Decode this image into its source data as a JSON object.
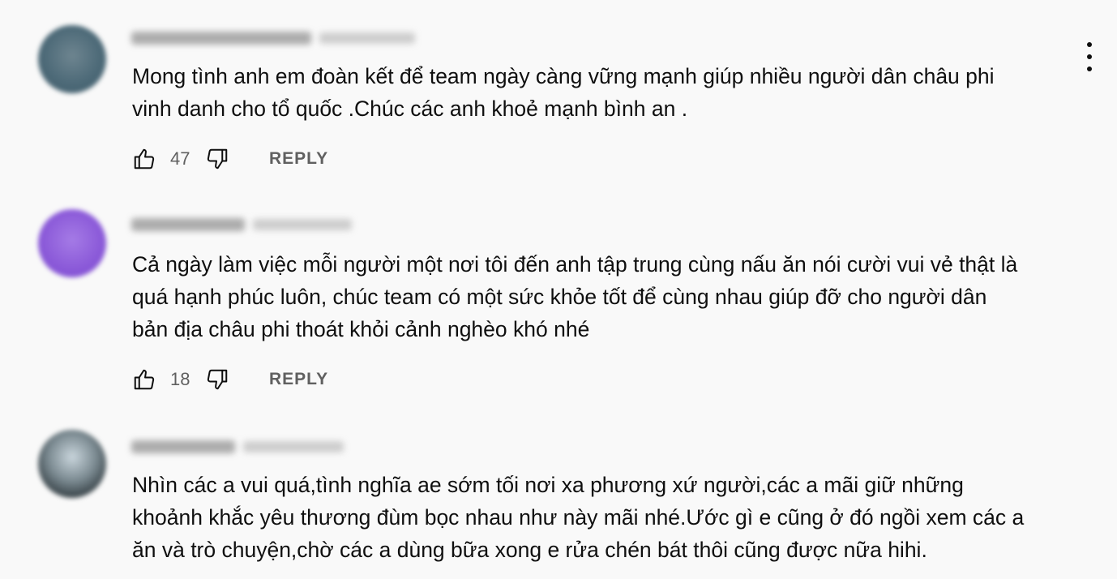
{
  "comments": [
    {
      "text_line1": "Mong tình anh em đoàn kết để team ngày càng vững mạnh giúp nhiều người dân châu phi",
      "text_line2": "vinh danh cho tổ quốc .Chúc các anh khoẻ mạnh bình an .",
      "likes": "47",
      "reply_label": "REPLY"
    },
    {
      "text_line1": "Cả ngày làm việc mỗi người một nơi tôi đến anh tập trung cùng nấu ăn nói cười vui vẻ thật là",
      "text_line2": "quá hạnh phúc luôn, chúc team có một sức khỏe tốt để cùng nhau giúp đỡ cho người dân",
      "text_line3": "bản địa châu phi thoát khỏi cảnh nghèo khó nhé",
      "likes": "18",
      "reply_label": "REPLY"
    },
    {
      "text_line1": "Nhìn các a vui quá,tình nghĩa ae sớm tối nơi xa phương xứ người,các a mãi giữ những",
      "text_line2": "khoảnh khắc yêu thương đùm bọc nhau như này mãi nhé.Ước gì e cũng ở đó ngồi xem các a",
      "text_line3": "ăn và trò chuyện,chờ các a dùng bữa xong e rửa chén bát thôi cũng được nữa hihi."
    }
  ],
  "icons": {
    "like": "thumbs-up-icon",
    "dislike": "thumbs-down-icon",
    "menu": "more-vertical-icon"
  },
  "colors": {
    "background": "#f9f9f9",
    "text": "#0f0f0f",
    "secondary_text": "#606060"
  }
}
